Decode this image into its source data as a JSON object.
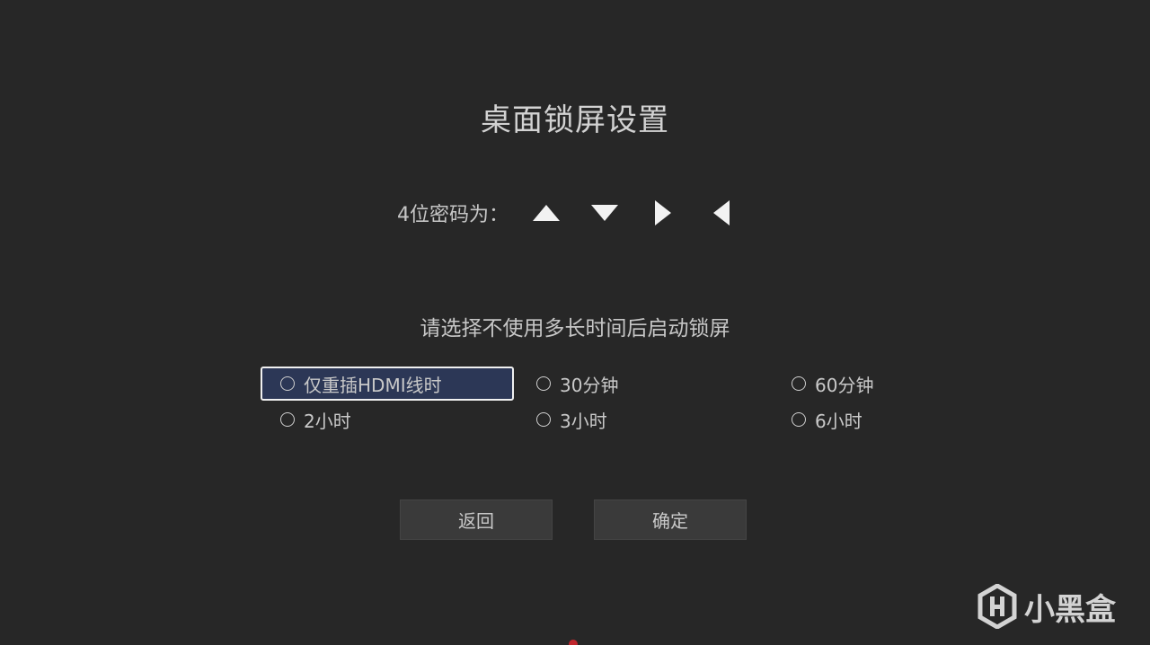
{
  "title": "桌面锁屏设置",
  "password": {
    "label": "4位密码为：",
    "sequence": [
      "arrow-up-icon",
      "arrow-down-icon",
      "arrow-right-icon",
      "arrow-left-icon"
    ]
  },
  "prompt": "请选择不使用多长时间后启动锁屏",
  "options": [
    {
      "label": "仅重插HDMI线时",
      "selected": true
    },
    {
      "label": "30分钟",
      "selected": false
    },
    {
      "label": "60分钟",
      "selected": false
    },
    {
      "label": "2小时",
      "selected": false
    },
    {
      "label": "3小时",
      "selected": false
    },
    {
      "label": "6小时",
      "selected": false
    }
  ],
  "buttons": {
    "back": "返回",
    "confirm": "确定"
  },
  "watermark": "小黑盒",
  "colors": {
    "background": "#272727",
    "selected_fill": "#2c3756",
    "selected_border": "#f0f0f0",
    "button": "#3a3a3a"
  }
}
